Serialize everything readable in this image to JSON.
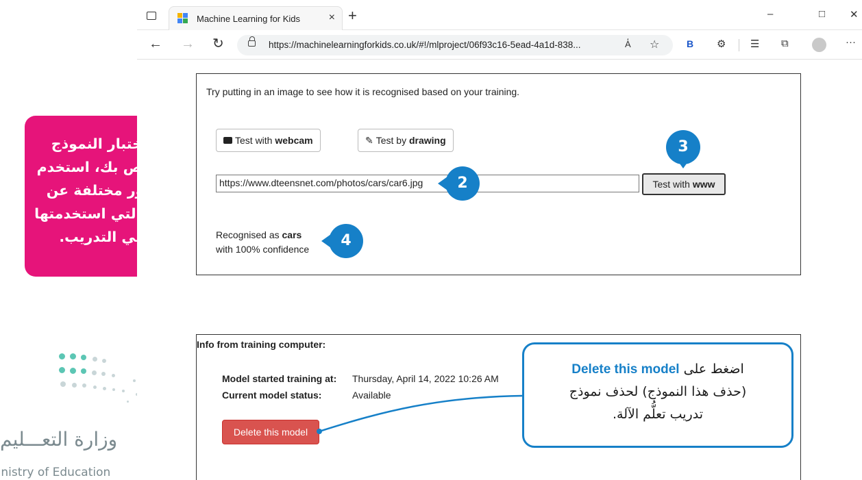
{
  "browser": {
    "tab_title": "Machine Learning for Kids",
    "tab_close": "×",
    "new_tab": "+",
    "win_min": "–",
    "win_max": "□",
    "win_close": "✕",
    "back": "←",
    "forward": "→",
    "reload": "↻",
    "url": "https://machinelearningforkids.co.uk/#!/mlproject/06f93c16-5ead-4a1d-838...",
    "read_aloud": "A̒",
    "favorite": "☆",
    "bing": "B",
    "extensions": "⚙",
    "favorites_bar": "☰",
    "collections": "⧉",
    "profile": "",
    "more": "···"
  },
  "test_panel": {
    "instruction": "Try putting in an image to see how it is recognised based on your training.",
    "webcam_prefix": "Test with ",
    "webcam_bold": "webcam",
    "drawing_prefix": "Test by ",
    "drawing_bold": "drawing",
    "url_value": "https://www.dteensnet.com/photos/cars/car6.jpg",
    "www_prefix": "Test with ",
    "www_bold": "www",
    "result_prefix": "Recognised as ",
    "result_label": "cars",
    "result_confidence": "with 100% confidence"
  },
  "info_panel": {
    "heading": "Info from training computer:",
    "started_label": "Model started training at:",
    "started_value": "Thursday, April 14, 2022 10:26 AM",
    "status_label": "Current model status:",
    "status_value": "Available",
    "delete_label": "Delete this model"
  },
  "annotations": {
    "pink_callout": [
      "لاختبار النموذج",
      "الخاص بك، استخدم",
      "صور مختلفة عن",
      "تلك التي استخدمتها",
      "في التدريب."
    ],
    "badge_2": "2",
    "badge_3": "3",
    "badge_4": "4",
    "blue_line1_ar": "اضغط على",
    "blue_line1_en": "Delete this model",
    "blue_line2": "(حذف هذا النموذج) لحذف نموذج",
    "blue_line3": "تدريب تعلُّم الآلة."
  },
  "logo": {
    "ministry_ar": "وزارة التعـــليم",
    "ministry_en": "Ministry of Education"
  },
  "colors": {
    "pink": "#e6147a",
    "blue": "#1680c8",
    "delete_red": "#d9534f",
    "logo_teal": "#5cc6b4"
  }
}
